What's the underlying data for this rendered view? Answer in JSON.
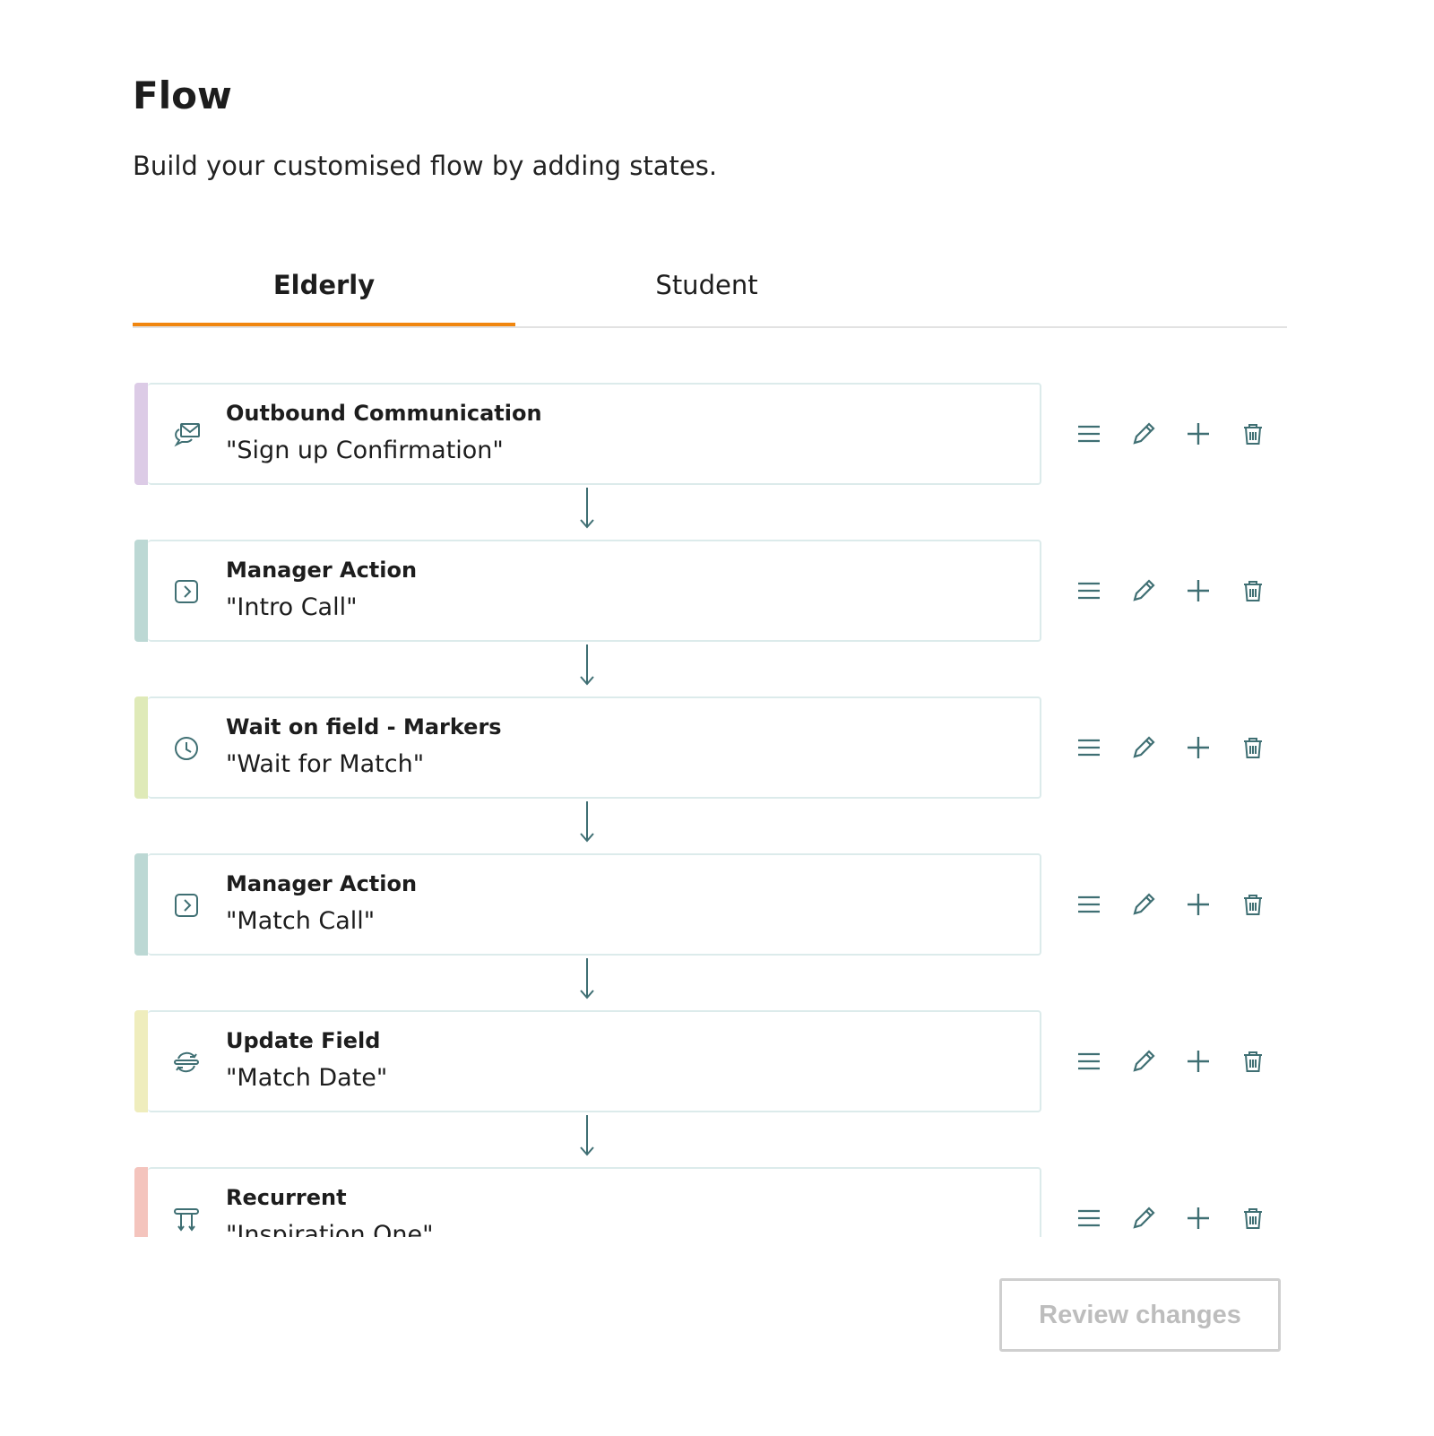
{
  "header": {
    "title": "Flow",
    "subtitle": "Build your customised flow by adding states."
  },
  "tabs": [
    {
      "label": "Elderly",
      "active": true
    },
    {
      "label": "Student",
      "active": false
    }
  ],
  "colors": {
    "accent": "#f0860f",
    "icon": "#3f6f73"
  },
  "states": [
    {
      "type": "Outbound Communication",
      "name": "\"Sign up Confirmation\"",
      "icon": "mail-chat-icon",
      "color": "#dccbe6"
    },
    {
      "type": "Manager Action",
      "name": "\"Intro Call\"",
      "icon": "chevron-square-icon",
      "color": "#bcd8d4"
    },
    {
      "type": "Wait on field - Markers",
      "name": "\"Wait for Match\"",
      "icon": "clock-icon",
      "color": "#dfeab8"
    },
    {
      "type": "Manager Action",
      "name": "\"Match Call\"",
      "icon": "chevron-square-icon",
      "color": "#bcd8d4"
    },
    {
      "type": "Update Field",
      "name": "\"Match Date\"",
      "icon": "refresh-icon",
      "color": "#efedbd"
    },
    {
      "type": "Recurrent",
      "name": "\"Inspiration One\"",
      "icon": "recurrent-icon",
      "color": "#f4c4bd"
    }
  ],
  "actions": [
    "reorder-icon",
    "pencil-icon",
    "plus-icon",
    "trash-icon"
  ],
  "footer": {
    "review_label": "Review changes"
  }
}
